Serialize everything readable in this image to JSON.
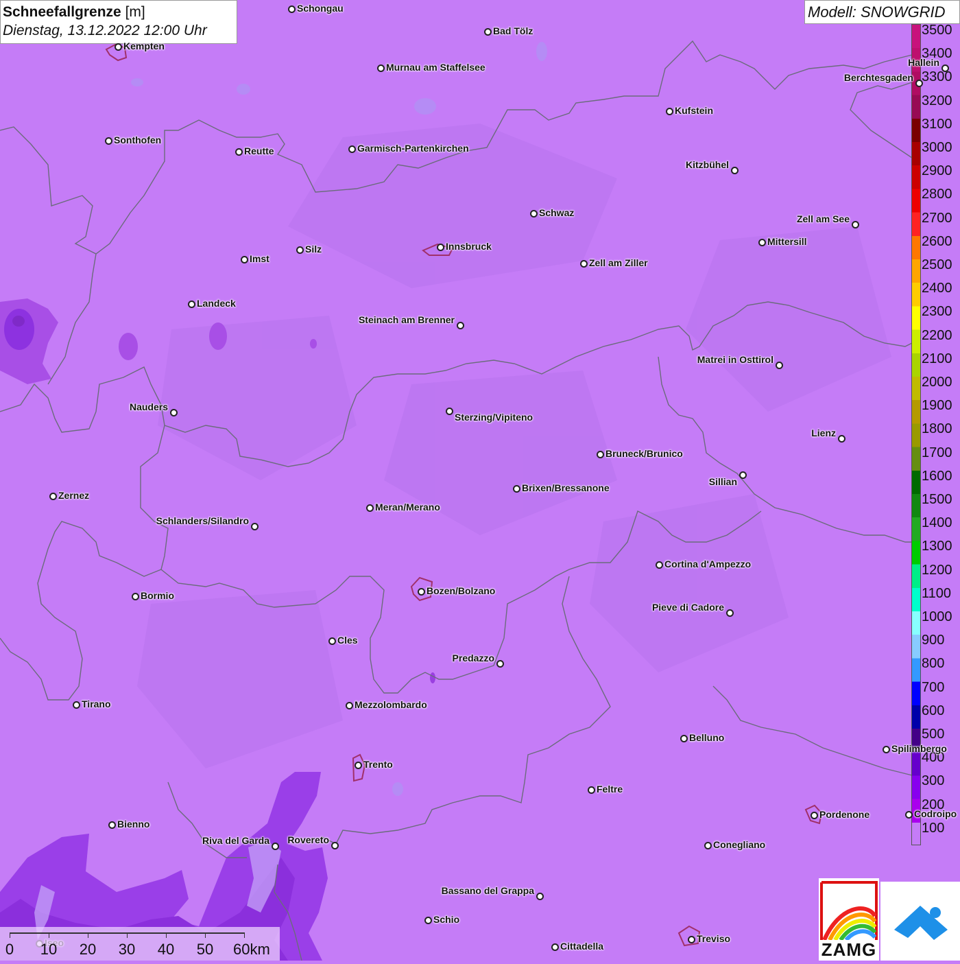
{
  "title": {
    "main": "Schneefallgrenze",
    "unit": "[m]",
    "date": "Dienstag, 13.12.2022 12:00 Uhr"
  },
  "model": "Modell: SNOWGRID",
  "legend": {
    "levels": [
      "3500",
      "3400",
      "3300",
      "3200",
      "3100",
      "3000",
      "2900",
      "2800",
      "2700",
      "2600",
      "2500",
      "2400",
      "2300",
      "2200",
      "2100",
      "2000",
      "1900",
      "1800",
      "1700",
      "1600",
      "1500",
      "1400",
      "1300",
      "1200",
      "1100",
      "1000",
      "900",
      "800",
      "700",
      "600",
      "500",
      "400",
      "300",
      "200",
      "100"
    ],
    "colors": [
      "#c8127c",
      "#be0f6e",
      "#b00c62",
      "#980a54",
      "#7a0000",
      "#a80000",
      "#cc0000",
      "#ee0000",
      "#ff2222",
      "#ff7700",
      "#ffa500",
      "#ffcc00",
      "#ffff00",
      "#ccee00",
      "#aad400",
      "#c0bb00",
      "#b59a00",
      "#9a9a00",
      "#668e11",
      "#006a00",
      "#118811",
      "#22aa22",
      "#00cc00",
      "#00ee88",
      "#00ffcc",
      "#88ffff",
      "#88ccff",
      "#3399ff",
      "#0000ff",
      "#0000aa",
      "#440088",
      "#6600cc",
      "#8800ee",
      "#aa00ee",
      "#c57cf7"
    ]
  },
  "cities": [
    {
      "name": "Schongau"
    },
    {
      "name": "Bad Tölz"
    },
    {
      "name": "Kempten"
    },
    {
      "name": "Murnau am Staffelsee"
    },
    {
      "name": "Berchtesgaden"
    },
    {
      "name": "Kufstein"
    },
    {
      "name": "Sonthofen"
    },
    {
      "name": "Reutte"
    },
    {
      "name": "Garmisch-Partenkirchen"
    },
    {
      "name": "Kitzbühel"
    },
    {
      "name": "Schwaz"
    },
    {
      "name": "Zell am See"
    },
    {
      "name": "Mittersill"
    },
    {
      "name": "Innsbruck"
    },
    {
      "name": "Imst"
    },
    {
      "name": "Silz"
    },
    {
      "name": "Zell am Ziller"
    },
    {
      "name": "Landeck"
    },
    {
      "name": "Steinach am Brenner"
    },
    {
      "name": "Matrei in Osttirol"
    },
    {
      "name": "Nauders"
    },
    {
      "name": "Sterzing/Vipiteno"
    },
    {
      "name": "Lienz"
    },
    {
      "name": "Bruneck/Brunico"
    },
    {
      "name": "Sillian"
    },
    {
      "name": "Zernez"
    },
    {
      "name": "Brixen/Bressanone"
    },
    {
      "name": "Meran/Merano"
    },
    {
      "name": "Schlanders/Silandro"
    },
    {
      "name": "Cortina d'Ampezzo"
    },
    {
      "name": "Bormio"
    },
    {
      "name": "Bozen/Bolzano"
    },
    {
      "name": "Pieve di Cadore"
    },
    {
      "name": "Cles"
    },
    {
      "name": "Predazzo"
    },
    {
      "name": "Tirano"
    },
    {
      "name": "Mezzolombardo"
    },
    {
      "name": "Belluno"
    },
    {
      "name": "Spilimbergo"
    },
    {
      "name": "Trento"
    },
    {
      "name": "Feltre"
    },
    {
      "name": "Pordenone"
    },
    {
      "name": "Bienno"
    },
    {
      "name": "Riva del Garda"
    },
    {
      "name": "Rovereto"
    },
    {
      "name": "Conegliano"
    },
    {
      "name": "Bassano del Grappa"
    },
    {
      "name": "Schio"
    },
    {
      "name": "Cittadella"
    },
    {
      "name": "Treviso"
    },
    {
      "name": "Hallein"
    },
    {
      "name": "Codroipo"
    },
    {
      "name": "Iseo"
    }
  ],
  "scale": {
    "labels": [
      "0",
      "10",
      "20",
      "30",
      "40",
      "50",
      "60km"
    ]
  },
  "logo": {
    "text": "ZAMG"
  }
}
